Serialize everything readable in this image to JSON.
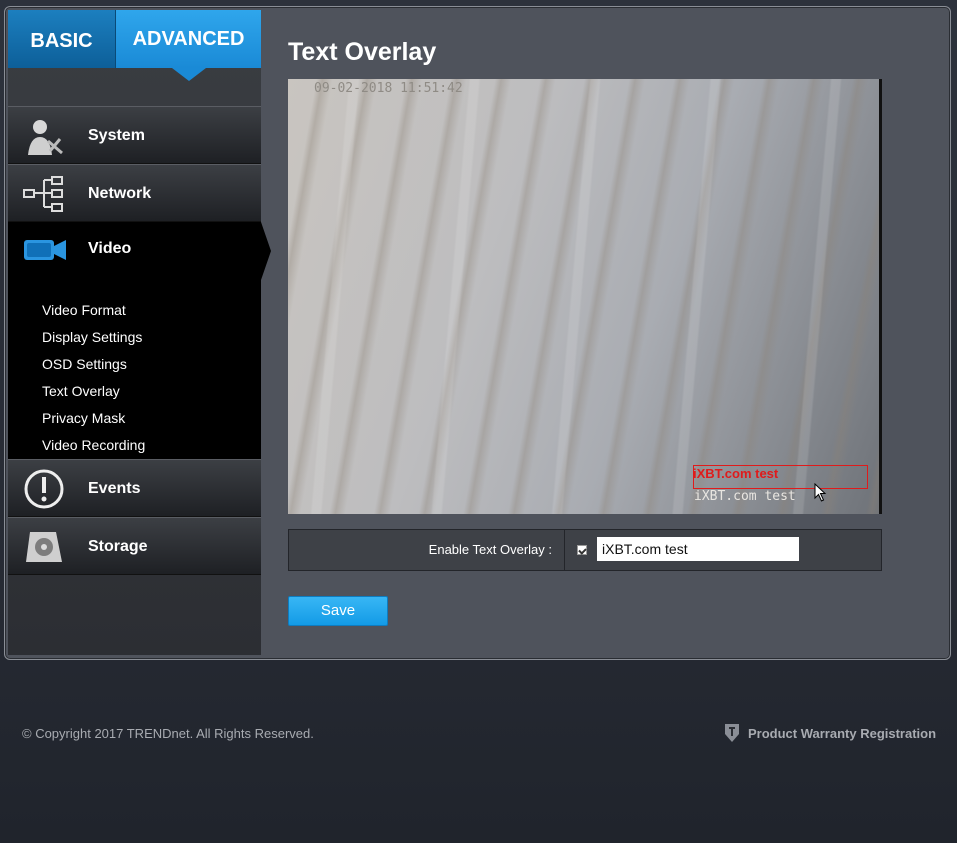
{
  "tabs": {
    "basic": "BASIC",
    "advanced": "ADVANCED"
  },
  "nav": {
    "system": {
      "label": "System",
      "icon": "system-admin-icon"
    },
    "network": {
      "label": "Network",
      "icon": "network-tree-icon"
    },
    "video": {
      "label": "Video",
      "icon": "video-camera-icon",
      "items": [
        "Video Format",
        "Display Settings",
        "OSD Settings",
        "Text Overlay",
        "Privacy Mask",
        "Video Recording"
      ]
    },
    "events": {
      "label": "Events",
      "icon": "exclamation-icon"
    },
    "storage": {
      "label": "Storage",
      "icon": "storage-disk-icon"
    }
  },
  "main": {
    "title": "Text Overlay",
    "preview": {
      "timestamp": "09-02-2018 11:51:42",
      "overlay_red": "iXBT.com test",
      "overlay_text": "iXBT.com test"
    },
    "setting": {
      "label": "Enable Text Overlay :",
      "checked": true,
      "value": "iXBT.com test"
    },
    "save_label": "Save"
  },
  "footer": {
    "copyright": "© Copyright 2017 TRENDnet. All Rights Reserved.",
    "warranty": "Product Warranty Registration"
  },
  "colors": {
    "accent": "#1a8ad6",
    "overlay_red": "#e01b1b"
  }
}
